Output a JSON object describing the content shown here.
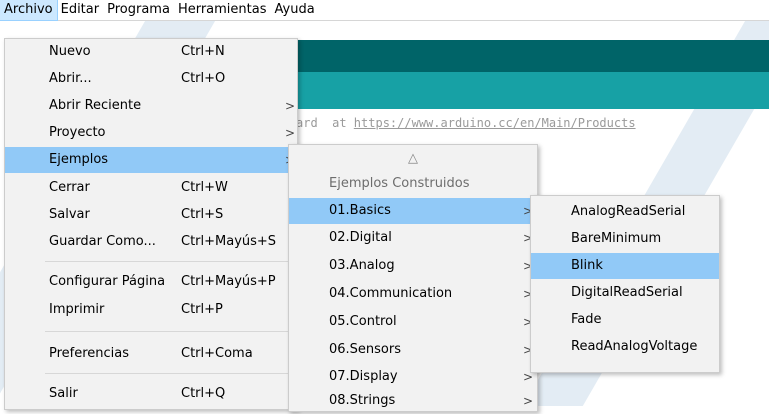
{
  "menubar": [
    "Archivo",
    "Editar",
    "Programa",
    "Herramientas",
    "Ayuda"
  ],
  "editor": {
    "line_prefix": "ard  at ",
    "line_url": "https://www.arduino.cc/en/Main/Products"
  },
  "file_menu": [
    {
      "label": "Nuevo",
      "shortcut": "Ctrl+N"
    },
    {
      "label": "Abrir...",
      "shortcut": "Ctrl+O"
    },
    {
      "label": "Abrir Reciente",
      "shortcut": ""
    },
    {
      "label": "Proyecto",
      "shortcut": ""
    },
    {
      "label": "Ejemplos",
      "shortcut": ""
    },
    {
      "label": "Cerrar",
      "shortcut": "Ctrl+W"
    },
    {
      "label": "Salvar",
      "shortcut": "Ctrl+S"
    },
    {
      "label": "Guardar Como...",
      "shortcut": "Ctrl+Mayús+S"
    },
    {
      "label": "Configurar Página",
      "shortcut": "Ctrl+Mayús+P"
    },
    {
      "label": "Imprimir",
      "shortcut": "Ctrl+P"
    },
    {
      "label": "Preferencias",
      "shortcut": "Ctrl+Coma"
    },
    {
      "label": "Salir",
      "shortcut": "Ctrl+Q"
    }
  ],
  "examples_menu": {
    "scroll_up": "△",
    "header": "Ejemplos Construidos",
    "items": [
      "01.Basics",
      "02.Digital",
      "03.Analog",
      "04.Communication",
      "05.Control",
      "06.Sensors",
      "07.Display",
      "08.Strings"
    ]
  },
  "basics_menu": [
    "AnalogReadSerial",
    "BareMinimum",
    "Blink",
    "DigitalReadSerial",
    "Fade",
    "ReadAnalogVoltage"
  ],
  "arrow": ">"
}
